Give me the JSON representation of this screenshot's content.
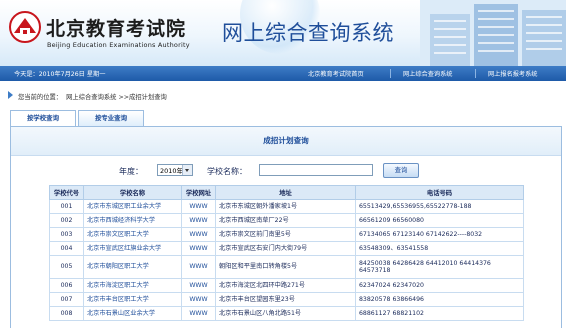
{
  "header": {
    "logo_cn": "北京教育考试院",
    "logo_en": "Beijing Education Examinations Authority",
    "system_title": "网上综合查询系统"
  },
  "navbar": {
    "date": "今天是：2010年7月26日 星期一",
    "links": [
      "北京教育考试院首页",
      "网上综合查询系统",
      "网上报名报考系统"
    ]
  },
  "breadcrumb": {
    "label": "您当前的位置：",
    "path": "网上综合查询系统 >>成招计划查询"
  },
  "tabs": [
    "按学校查询",
    "按专业查询"
  ],
  "panel": {
    "title": "成招计划查询"
  },
  "form": {
    "year_label": "年度：",
    "year_value": "2010年",
    "school_label": "学校名称：",
    "school_value": "",
    "query_button": "查询"
  },
  "table": {
    "headers": [
      "学校代号",
      "学校名称",
      "学校网址",
      "地址",
      "电话号码"
    ],
    "rows": [
      {
        "code": "001",
        "name": "北京市东城区职工业余大学",
        "web": "WWW",
        "address": "北京市东城区朝外潘家坡1号",
        "phone": "65513429,65536955,65522778-188"
      },
      {
        "code": "002",
        "name": "北京市西城经济科学大学",
        "web": "WWW",
        "address": "北京市西城区南草厂22号",
        "phone": "66561209 66560080"
      },
      {
        "code": "003",
        "name": "北京市崇文区职工大学",
        "web": "WWW",
        "address": "北京市崇文区前门南里5号",
        "phone": "67134065 67123140 67142622----8032"
      },
      {
        "code": "004",
        "name": "北京市宣武区红旗业余大学",
        "web": "WWW",
        "address": "北京市宣武区右安门内大街79号",
        "phone": "63548309、63541558"
      },
      {
        "code": "005",
        "name": "北京市朝阳区职工大学",
        "web": "WWW",
        "address": "朝阳区和平里南口转角楼5号",
        "phone": "84250038 64286428 64412010 64414376 64573718"
      },
      {
        "code": "006",
        "name": "北京市海淀区职工大学",
        "web": "WWW",
        "address": "北京市海淀区北四环中路271号",
        "phone": "62347024 62347020"
      },
      {
        "code": "007",
        "name": "北京市丰台区职工大学",
        "web": "WWW",
        "address": "北京市丰台区望园东里23号",
        "phone": "83820578 63866496"
      },
      {
        "code": "008",
        "name": "北京市石景山区业余大学",
        "web": "WWW",
        "address": "北京市石景山区八角北路51号",
        "phone": "68861127 68821102"
      }
    ]
  }
}
